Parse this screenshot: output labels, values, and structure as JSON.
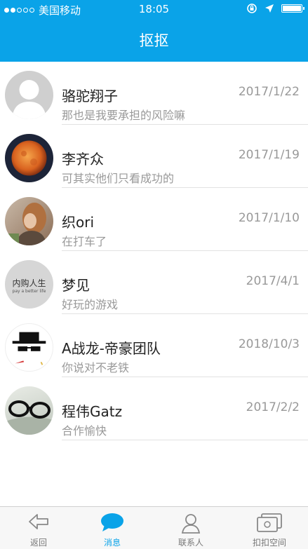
{
  "status": {
    "carrier": "美国移动",
    "time": "18:05"
  },
  "header": {
    "title": "抠抠"
  },
  "conversations": [
    {
      "name": "骆驼翔子",
      "message": "那也是我要承担的风险嘛",
      "date": "2017/1/22",
      "avatar": "default-user-avatar"
    },
    {
      "name": "李齐众",
      "message": "可其实他们只看成功的",
      "date": "2017/1/19",
      "avatar": "moon-photo-avatar"
    },
    {
      "name": "织ori",
      "message": "在打车了",
      "date": "2017/1/10",
      "avatar": "portrait-photo-avatar"
    },
    {
      "name": "梦见",
      "message": "好玩的游戏",
      "date": "2017/4/1",
      "avatar": "text-avatar",
      "avatar_text": "内购人生",
      "avatar_subtext": "pay a better life"
    },
    {
      "name": "A战龙-帝豪团队",
      "message": "你说对不老铁",
      "date": "2018/10/3",
      "avatar": "hat-sunglasses-avatar"
    },
    {
      "name": "程伟Gatz",
      "message": "合作愉快",
      "date": "2017/2/2",
      "avatar": "glasses-photo-avatar"
    }
  ],
  "tabs": [
    {
      "label": "返回",
      "icon": "back-arrow-icon"
    },
    {
      "label": "消息",
      "icon": "chat-bubble-icon",
      "active": true
    },
    {
      "label": "联系人",
      "icon": "contacts-icon"
    },
    {
      "label": "扣扣空间",
      "icon": "space-icon"
    }
  ],
  "colors": {
    "accent": "#0aa3e8",
    "secondary_text": "#999999",
    "primary_text": "#222222"
  }
}
